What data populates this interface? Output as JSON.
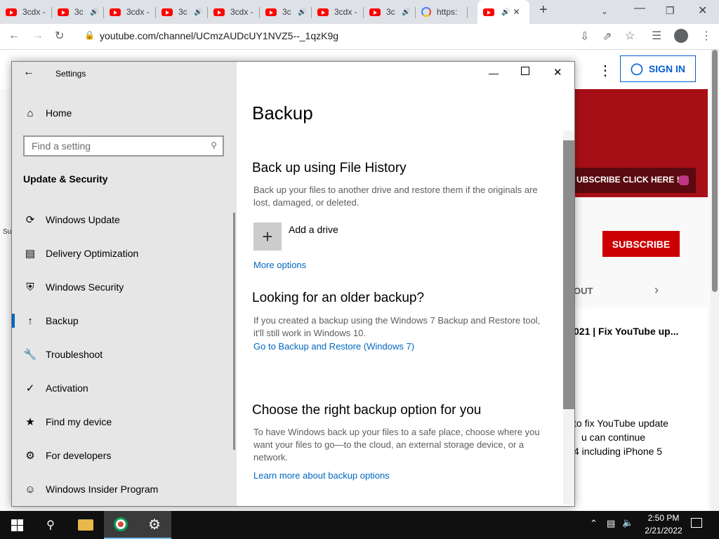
{
  "browser": {
    "tabs": [
      {
        "label": "3cdx -",
        "audio": false,
        "favicon": "youtube-icon"
      },
      {
        "label": "3c",
        "audio": true,
        "favicon": "youtube-icon"
      },
      {
        "label": "3cdx -",
        "audio": false,
        "favicon": "youtube-icon"
      },
      {
        "label": "3c",
        "audio": true,
        "favicon": "youtube-icon"
      },
      {
        "label": "3cdx -",
        "audio": false,
        "favicon": "youtube-icon"
      },
      {
        "label": "3c",
        "audio": true,
        "favicon": "youtube-icon"
      },
      {
        "label": "3cdx -",
        "audio": false,
        "favicon": "youtube-icon"
      },
      {
        "label": "3c",
        "audio": true,
        "favicon": "youtube-icon"
      },
      {
        "label": "https:",
        "audio": false,
        "favicon": "google-icon"
      }
    ],
    "url": "youtube.com/channel/UCmzAUDcUY1NVZ5--_1qzK9g"
  },
  "youtube": {
    "sign_in": "SIGN IN",
    "banner_text": "UBSCRIBE CLICK HERE !",
    "subscribe": "SUBSCRIBE",
    "tab_about": "OUT",
    "video_title": "021 | Fix YouTube up...",
    "desc_line1": "to fix YouTube update",
    "desc_line2": "u can continue",
    "desc_line3": "4 including iPhone 5",
    "left_fragment": "Su"
  },
  "settings": {
    "window_title": "Settings",
    "home": "Home",
    "search_placeholder": "Find a setting",
    "section": "Update & Security",
    "nav": [
      {
        "label": "Windows Update",
        "icon": "sync-icon"
      },
      {
        "label": "Delivery Optimization",
        "icon": "delivery-icon"
      },
      {
        "label": "Windows Security",
        "icon": "shield-icon"
      },
      {
        "label": "Backup",
        "icon": "backup-arrow-icon",
        "selected": true
      },
      {
        "label": "Troubleshoot",
        "icon": "wrench-icon"
      },
      {
        "label": "Activation",
        "icon": "check-circle-icon"
      },
      {
        "label": "Find my device",
        "icon": "person-pin-icon"
      },
      {
        "label": "For developers",
        "icon": "developer-icon"
      },
      {
        "label": "Windows Insider Program",
        "icon": "insider-cat-icon"
      }
    ],
    "page_title": "Backup",
    "file_history_heading": "Back up using File History",
    "file_history_desc": "Back up your files to another drive and restore them if the originals are lost, damaged, or deleted.",
    "add_drive": "Add a drive",
    "more_options": "More options",
    "older_heading": "Looking for an older backup?",
    "older_desc": "If you created a backup using the Windows 7 Backup and Restore tool, it'll still work in Windows 10.",
    "older_link": "Go to Backup and Restore (Windows 7)",
    "choose_heading": "Choose the right backup option for you",
    "choose_desc": "To have Windows back up your files to a safe place, choose where you want your files to go—to the cloud, an external storage device, or a network.",
    "choose_link": "Learn more about backup options"
  },
  "taskbar": {
    "time": "2:50 PM",
    "date": "2/21/2022"
  },
  "colors": {
    "accent": "#0067c0",
    "youtube_red": "#cc0000",
    "taskbar": "#101010"
  }
}
